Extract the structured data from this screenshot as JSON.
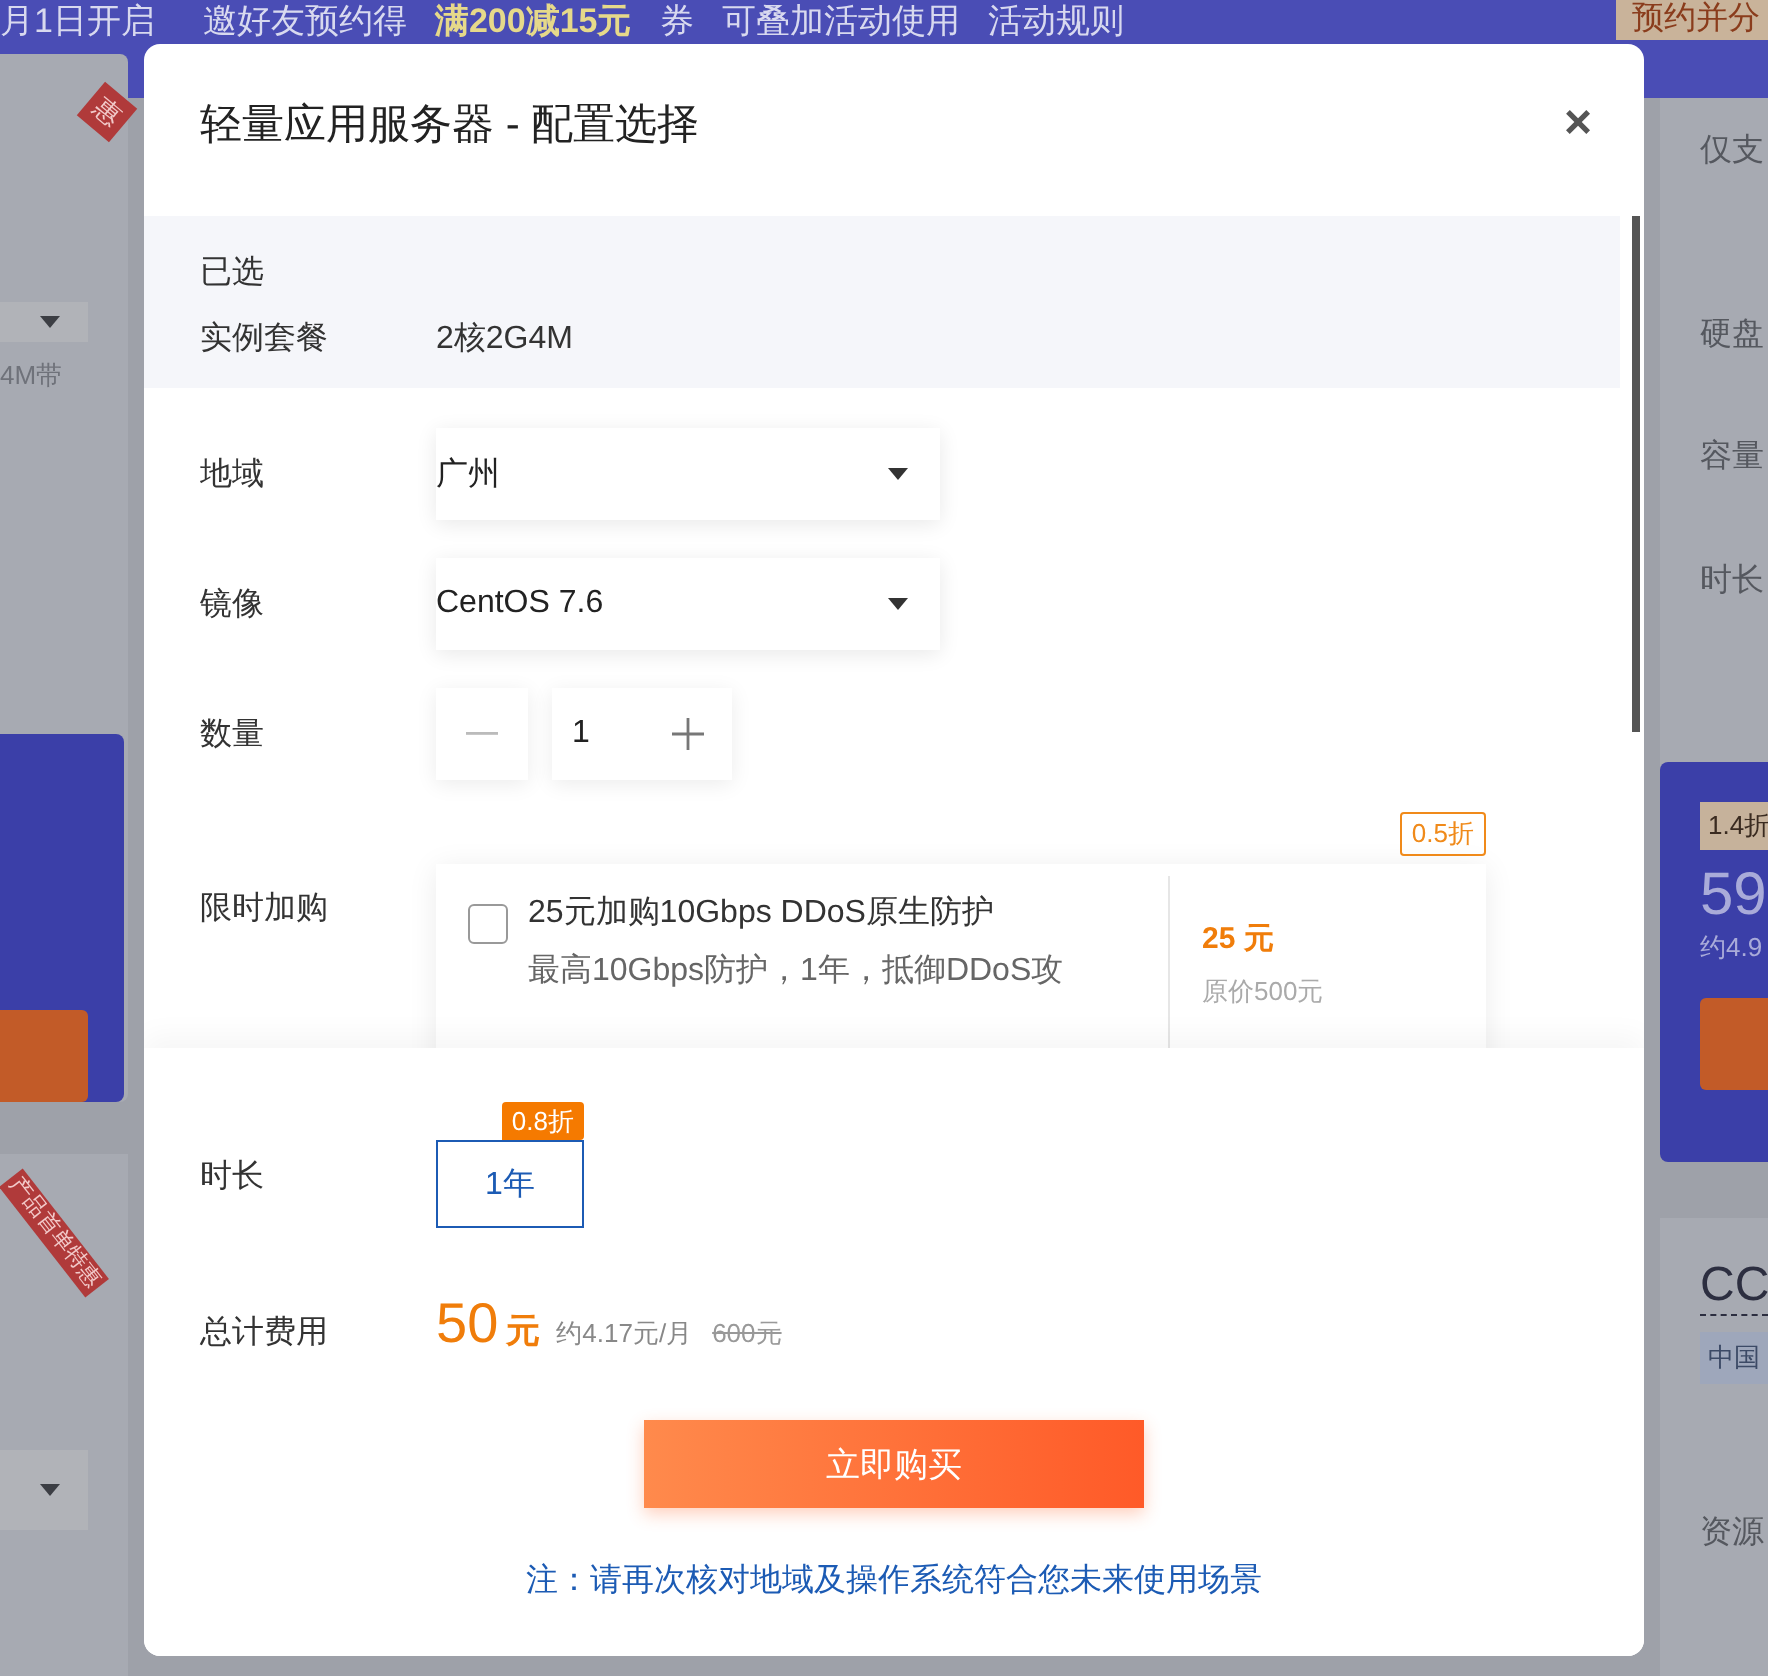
{
  "background": {
    "banner": {
      "date": "月1日开启",
      "invite": "邀好友预约得",
      "highlight": "满200减15元",
      "coupon": "券",
      "stack": "可叠加活动使用",
      "rules": "活动规则"
    },
    "corner_banner": "预约并分",
    "left": {
      "ribbon_top": "惠",
      "spec": "4M带",
      "ribbon": "产品首单特惠"
    },
    "right": {
      "lines": [
        "仅支",
        "硬盘",
        "容量",
        "时长"
      ],
      "discount": "1.4折",
      "price": "59",
      "monthly": "约4.9",
      "title": "CC",
      "tag": "中国",
      "footer": "资源"
    }
  },
  "dialog": {
    "title": "轻量应用服务器 - 配置选择",
    "close": "×",
    "selected": {
      "heading": "已选",
      "label": "实例套餐",
      "value": "2核2G4M"
    },
    "fields": [
      {
        "kind": "select",
        "label": "地域",
        "value": "广州"
      },
      {
        "kind": "select",
        "label": "镜像",
        "value": "CentOS 7.6"
      },
      {
        "kind": "stepper",
        "label": "数量",
        "value": "1"
      }
    ],
    "addon": {
      "label": "限时加购",
      "checked": false,
      "title": "25元加购10Gbps DDoS原生防护",
      "desc": "最高10Gbps防护，1年，抵御DDoS攻",
      "price": "25",
      "unit": "元",
      "original": "原价500元",
      "badge": "0.5折"
    },
    "duration": {
      "label": "时长",
      "options": [
        {
          "text": "1年",
          "badge": "0.8折",
          "selected": true
        }
      ]
    },
    "total": {
      "label": "总计费用",
      "amount": "50",
      "unit": "元",
      "monthly": "约4.17元/月",
      "original": "600元"
    },
    "buy_button": "立即购买",
    "note": "注：请再次核对地域及操作系统符合您未来使用场景"
  }
}
